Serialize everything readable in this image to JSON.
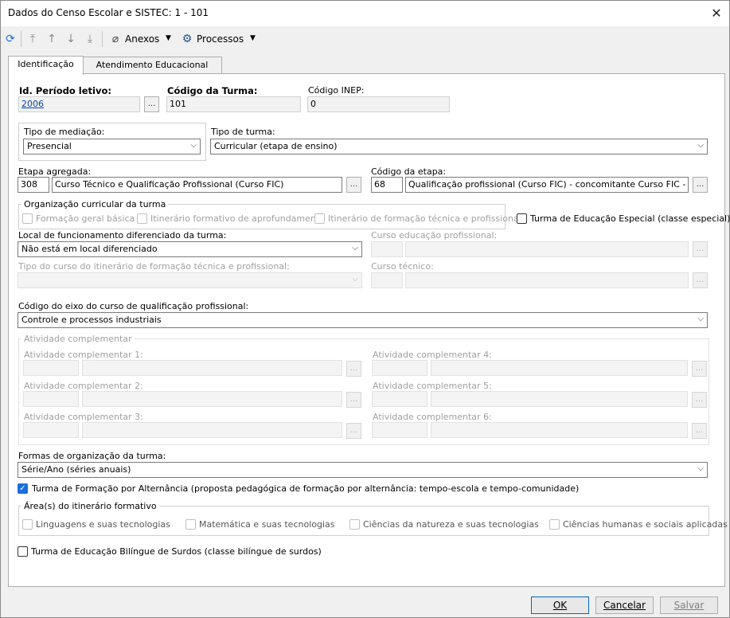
{
  "window": {
    "title": "Dados do Censo Escolar e SISTEC: 1 - 101"
  },
  "toolbar": {
    "anexos": "Anexos",
    "processos": "Processos"
  },
  "tabs": [
    "Identificação",
    "Atendimento Educacional"
  ],
  "form": {
    "id_periodo_label": "Id. Período letivo:",
    "id_periodo_value": "2006",
    "codigo_turma_label": "Código da Turma:",
    "codigo_turma_value": "101",
    "codigo_inep_label": "Código INEP:",
    "codigo_inep_value": "0",
    "tipo_mediacao_label": "Tipo de mediação:",
    "tipo_mediacao_value": "Presencial",
    "tipo_turma_label": "Tipo de turma:",
    "tipo_turma_value": "Curricular (etapa de ensino)",
    "etapa_agregada_label": "Etapa agregada:",
    "etapa_agregada_code": "308",
    "etapa_agregada_desc": "Curso Técnico e Qualificação Profissional (Curso FIC)",
    "codigo_etapa_label": "Código da etapa:",
    "codigo_etapa_code": "68",
    "codigo_etapa_desc": "Qualificação profissional (Curso FIC) - concomitante Curso FIC - concomitan",
    "org_curricular_label": "Organização curricular da turma",
    "org_opt1": "Formação geral básica",
    "org_opt2": "Itinerário formativo de aprofundamento",
    "org_opt3": "Itinerário de formação técnica e profissional",
    "educacao_especial": "Turma de Educação Especial (classe especial)",
    "local_func_label": "Local de funcionamento diferenciado da turma:",
    "local_func_value": "Não está em local diferenciado",
    "curso_ed_prof_label": "Curso educação profissional:",
    "tipo_curso_label": "Tipo do curso do itinerário de formação técnica e profissional:",
    "curso_tecnico_label": "Curso técnico:",
    "eixo_label": "Código do eixo do curso de qualificação profissional:",
    "eixo_value": "Controle e processos industriais",
    "ativ_comp_group": "Atividade complementar",
    "ativ1": "Atividade complementar 1:",
    "ativ2": "Atividade complementar 2:",
    "ativ3": "Atividade complementar 3:",
    "ativ4": "Atividade complementar 4:",
    "ativ5": "Atividade complementar 5:",
    "ativ6": "Atividade complementar 6:",
    "formas_label": "Formas de organização da turma:",
    "formas_value": "Série/Ano (séries anuais)",
    "alternancia": "Turma de Formação por Alternância (proposta pedagógica de formação por alternância: tempo-escola e tempo-comunidade)",
    "areas_group": "Área(s) do itinerário formativo",
    "area1": "Linguagens e suas tecnologias",
    "area2": "Matemática e suas tecnologias",
    "area3": "Ciências da natureza e suas tecnologias",
    "area4": "Ciências humanas e sociais aplicadas",
    "bilingue": "Turma de Educação Bilíngue de Surdos (classe bilíngue de surdos)",
    "ellipsis": "..."
  },
  "footer": {
    "ok": "OK",
    "cancelar": "Cancelar",
    "salvar": "Salvar"
  }
}
